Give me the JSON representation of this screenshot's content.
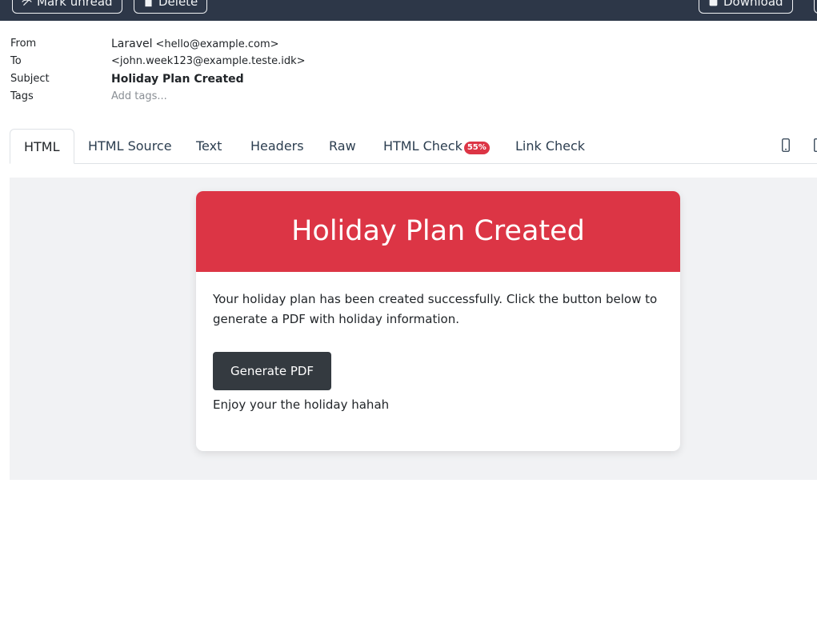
{
  "toolbar": {
    "mark_unread_label": "Mark unread",
    "delete_label": "Delete",
    "download_label": "Download"
  },
  "meta": {
    "from_label": "From",
    "from_name": "Laravel",
    "from_email": "<hello@example.com>",
    "to_label": "To",
    "to_value": "<john.week123@example.teste.idk>",
    "subject_label": "Subject",
    "subject_value": "Holiday Plan Created",
    "tags_label": "Tags",
    "tags_placeholder": "Add tags..."
  },
  "tabs": {
    "html": "HTML",
    "html_source": "HTML Source",
    "text": "Text",
    "headers": "Headers",
    "raw": "Raw",
    "html_check": "HTML Check",
    "html_check_badge": "55%",
    "link_check": "Link Check"
  },
  "email": {
    "header_title": "Holiday Plan Created",
    "body_text": "Your holiday plan has been created successfully. Click the button below to generate a PDF with holiday information.",
    "button_label": "Generate PDF",
    "footer_text": "Enjoy your the holiday hahah"
  },
  "colors": {
    "toolbar_bg": "#2d3748",
    "accent_red": "#dc3545",
    "button_dark": "#343a40",
    "preview_bg": "#f1f2f4"
  }
}
